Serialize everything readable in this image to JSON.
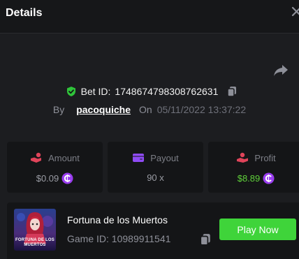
{
  "header": {
    "title": "Details",
    "close_icon": "close-icon"
  },
  "bet": {
    "id_label": "Bet ID:",
    "id_value": "1748674798308762631",
    "by_label": "By",
    "username": "pacoquiche",
    "on_label": "On",
    "datetime": "05/11/2022 13:37:22"
  },
  "stats": {
    "amount": {
      "label": "Amount",
      "value": "$0.09",
      "icon": "coins-hand-icon"
    },
    "payout": {
      "label": "Payout",
      "value": "90 x",
      "icon": "wallet-icon"
    },
    "profit": {
      "label": "Profit",
      "value": "$8.89",
      "icon": "profit-person-icon"
    }
  },
  "game": {
    "name": "Fortuna de los Muertos",
    "id_label": "Game ID:",
    "id_value": "10989911541",
    "thumb_text": "FORTUNA DE LOS MUERTOS",
    "play_label": "Play Now"
  },
  "colors": {
    "accent_green": "#3fd43a",
    "profit_green": "#5fd13a",
    "shield_green": "#2fc43a",
    "icon_red": "#e0445a",
    "icon_purple": "#8f4bf5",
    "coin_purple": "#9a3df0"
  }
}
